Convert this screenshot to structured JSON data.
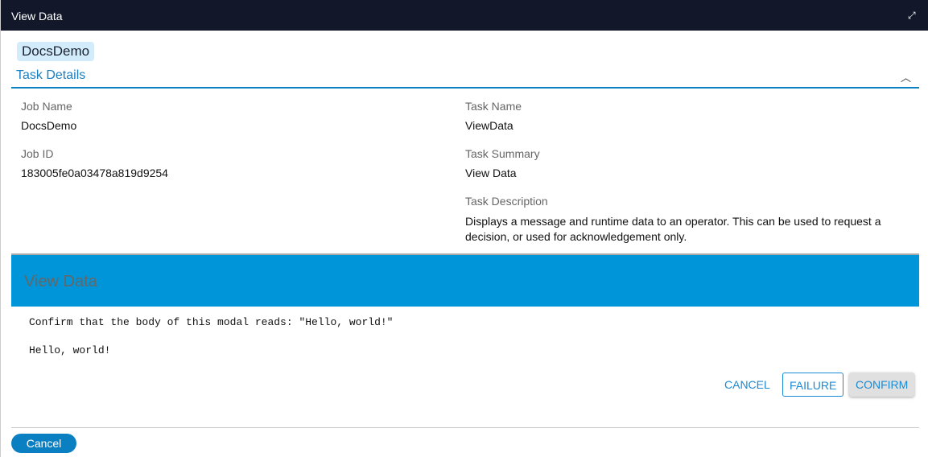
{
  "window": {
    "title": "View Data"
  },
  "job_chip": "DocsDemo",
  "section": {
    "title": "Task Details"
  },
  "fields": {
    "job_name_label": "Job Name",
    "job_name": "DocsDemo",
    "job_id_label": "Job ID",
    "job_id": "183005fe0a03478a819d9254",
    "task_name_label": "Task Name",
    "task_name": "ViewData",
    "task_summary_label": "Task Summary",
    "task_summary": "View Data",
    "task_description_label": "Task Description",
    "task_description": "Displays a message and runtime data to an operator. This can be used to request a decision, or used for acknowledgement only."
  },
  "panel": {
    "title": "View Data",
    "message": "Confirm that the body of this modal reads: \"Hello, world!\"",
    "body": "Hello, world!",
    "cancel": "CANCEL",
    "failure": "FAILURE",
    "confirm": "CONFIRM"
  },
  "footer": {
    "cancel": "Cancel"
  },
  "colors": {
    "titlebar": "#121829",
    "accent": "#0a7fc2",
    "panel_header": "#0095d9"
  }
}
